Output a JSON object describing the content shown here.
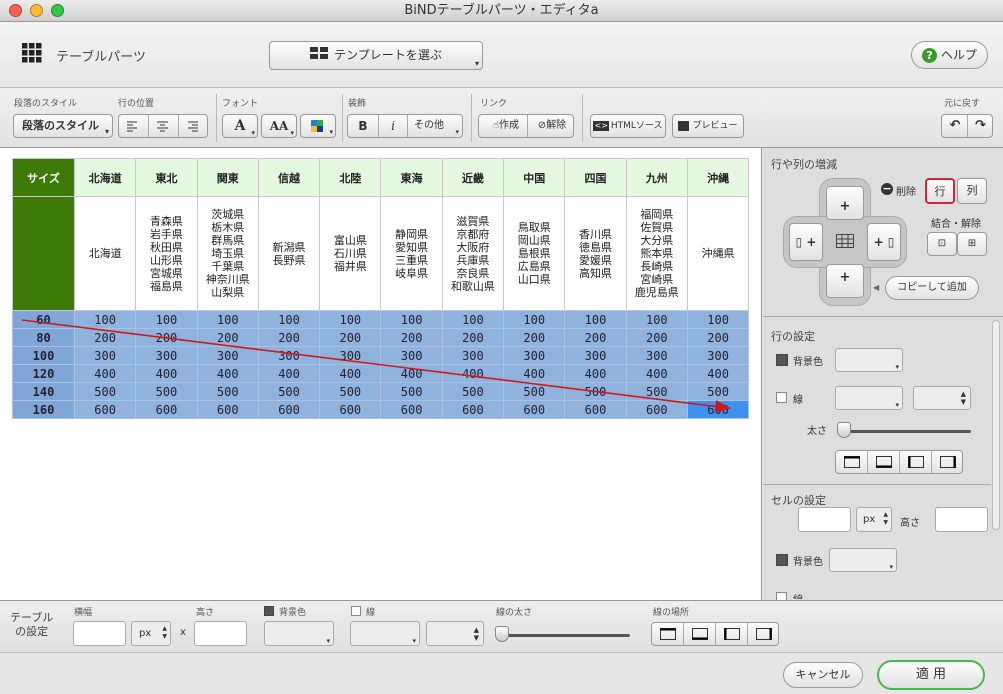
{
  "window": {
    "title": "BiNDテーブルパーツ・エディタa"
  },
  "header": {
    "title": "テーブルパーツ",
    "template_button": "テンプレートを選ぶ",
    "help_button": "ヘルプ"
  },
  "toolbar": {
    "groups": {
      "paragraph_style": "段落のスタイル",
      "row_position": "行の位置",
      "font": "フォント",
      "decoration": "装飾",
      "link": "リンク",
      "undo": "元に戻す"
    },
    "paragraph_style_value": "段落のスタイル",
    "font_a": "A",
    "font_aa": "AA",
    "bold": "B",
    "italic": "i",
    "other": "その他",
    "link_create": "作成",
    "link_remove": "解除",
    "html_source": "HTMLソース",
    "preview": "プレビュー"
  },
  "table": {
    "headers": [
      "サイズ",
      "北海道",
      "東北",
      "関東",
      "信越",
      "北陸",
      "東海",
      "近畿",
      "中国",
      "四国",
      "九州",
      "沖縄"
    ],
    "regions": [
      [
        ""
      ],
      [
        "北海道"
      ],
      [
        "青森県",
        "岩手県",
        "秋田県",
        "山形県",
        "宮城県",
        "福島県"
      ],
      [
        "茨城県",
        "栃木県",
        "群馬県",
        "埼玉県",
        "千葉県",
        "神奈川県",
        "山梨県"
      ],
      [
        "新潟県",
        "長野県"
      ],
      [
        "富山県",
        "石川県",
        "福井県"
      ],
      [
        "静岡県",
        "愛知県",
        "三重県",
        "岐阜県"
      ],
      [
        "滋賀県",
        "京都府",
        "大阪府",
        "兵庫県",
        "奈良県",
        "和歌山県"
      ],
      [
        "鳥取県",
        "岡山県",
        "島根県",
        "広島県",
        "山口県"
      ],
      [
        "香川県",
        "徳島県",
        "愛媛県",
        "高知県"
      ],
      [
        "福岡県",
        "佐賀県",
        "大分県",
        "熊本県",
        "長崎県",
        "宮崎県",
        "鹿児島県"
      ],
      [
        "沖縄県"
      ]
    ],
    "rows": [
      [
        "60",
        "100",
        "100",
        "100",
        "100",
        "100",
        "100",
        "100",
        "100",
        "100",
        "100",
        "100"
      ],
      [
        "80",
        "200",
        "200",
        "200",
        "200",
        "200",
        "200",
        "200",
        "200",
        "200",
        "200",
        "200"
      ],
      [
        "100",
        "300",
        "300",
        "300",
        "300",
        "300",
        "300",
        "300",
        "300",
        "300",
        "300",
        "300"
      ],
      [
        "120",
        "400",
        "400",
        "400",
        "400",
        "400",
        "400",
        "400",
        "400",
        "400",
        "400",
        "400"
      ],
      [
        "140",
        "500",
        "500",
        "500",
        "500",
        "500",
        "500",
        "500",
        "500",
        "500",
        "500",
        "500"
      ],
      [
        "160",
        "600",
        "600",
        "600",
        "600",
        "600",
        "600",
        "600",
        "600",
        "600",
        "600",
        "600"
      ]
    ]
  },
  "right_panel": {
    "rowcol_title": "行や列の増減",
    "delete_label": "削除",
    "row_button": "行",
    "col_button": "列",
    "merge_label": "結合・解除",
    "copy_add": "コピーして追加",
    "row_settings": "行の設定",
    "bg_color": "背景色",
    "line": "線",
    "thickness": "太さ",
    "cell_settings": "セルの設定",
    "unit_px": "px",
    "height": "高さ",
    "bg_color2": "背景色",
    "line2": "線"
  },
  "table_settings": {
    "title_line1": "テーブル",
    "title_line2": "の設定",
    "width": "横幅",
    "height": "高さ",
    "unit_px": "px",
    "times": "x",
    "bg_color": "背景色",
    "line": "線",
    "line_thickness": "線の太さ",
    "line_location": "線の場所"
  },
  "footer": {
    "cancel": "キャンセル",
    "apply": "適 用"
  },
  "colors": {
    "header_green": "#3d7a08",
    "head_row": "#e3f8df",
    "selected_rows": "#8fb3dd",
    "arrow_red": "#cc1a1a",
    "apply_border": "#4bb84b"
  }
}
